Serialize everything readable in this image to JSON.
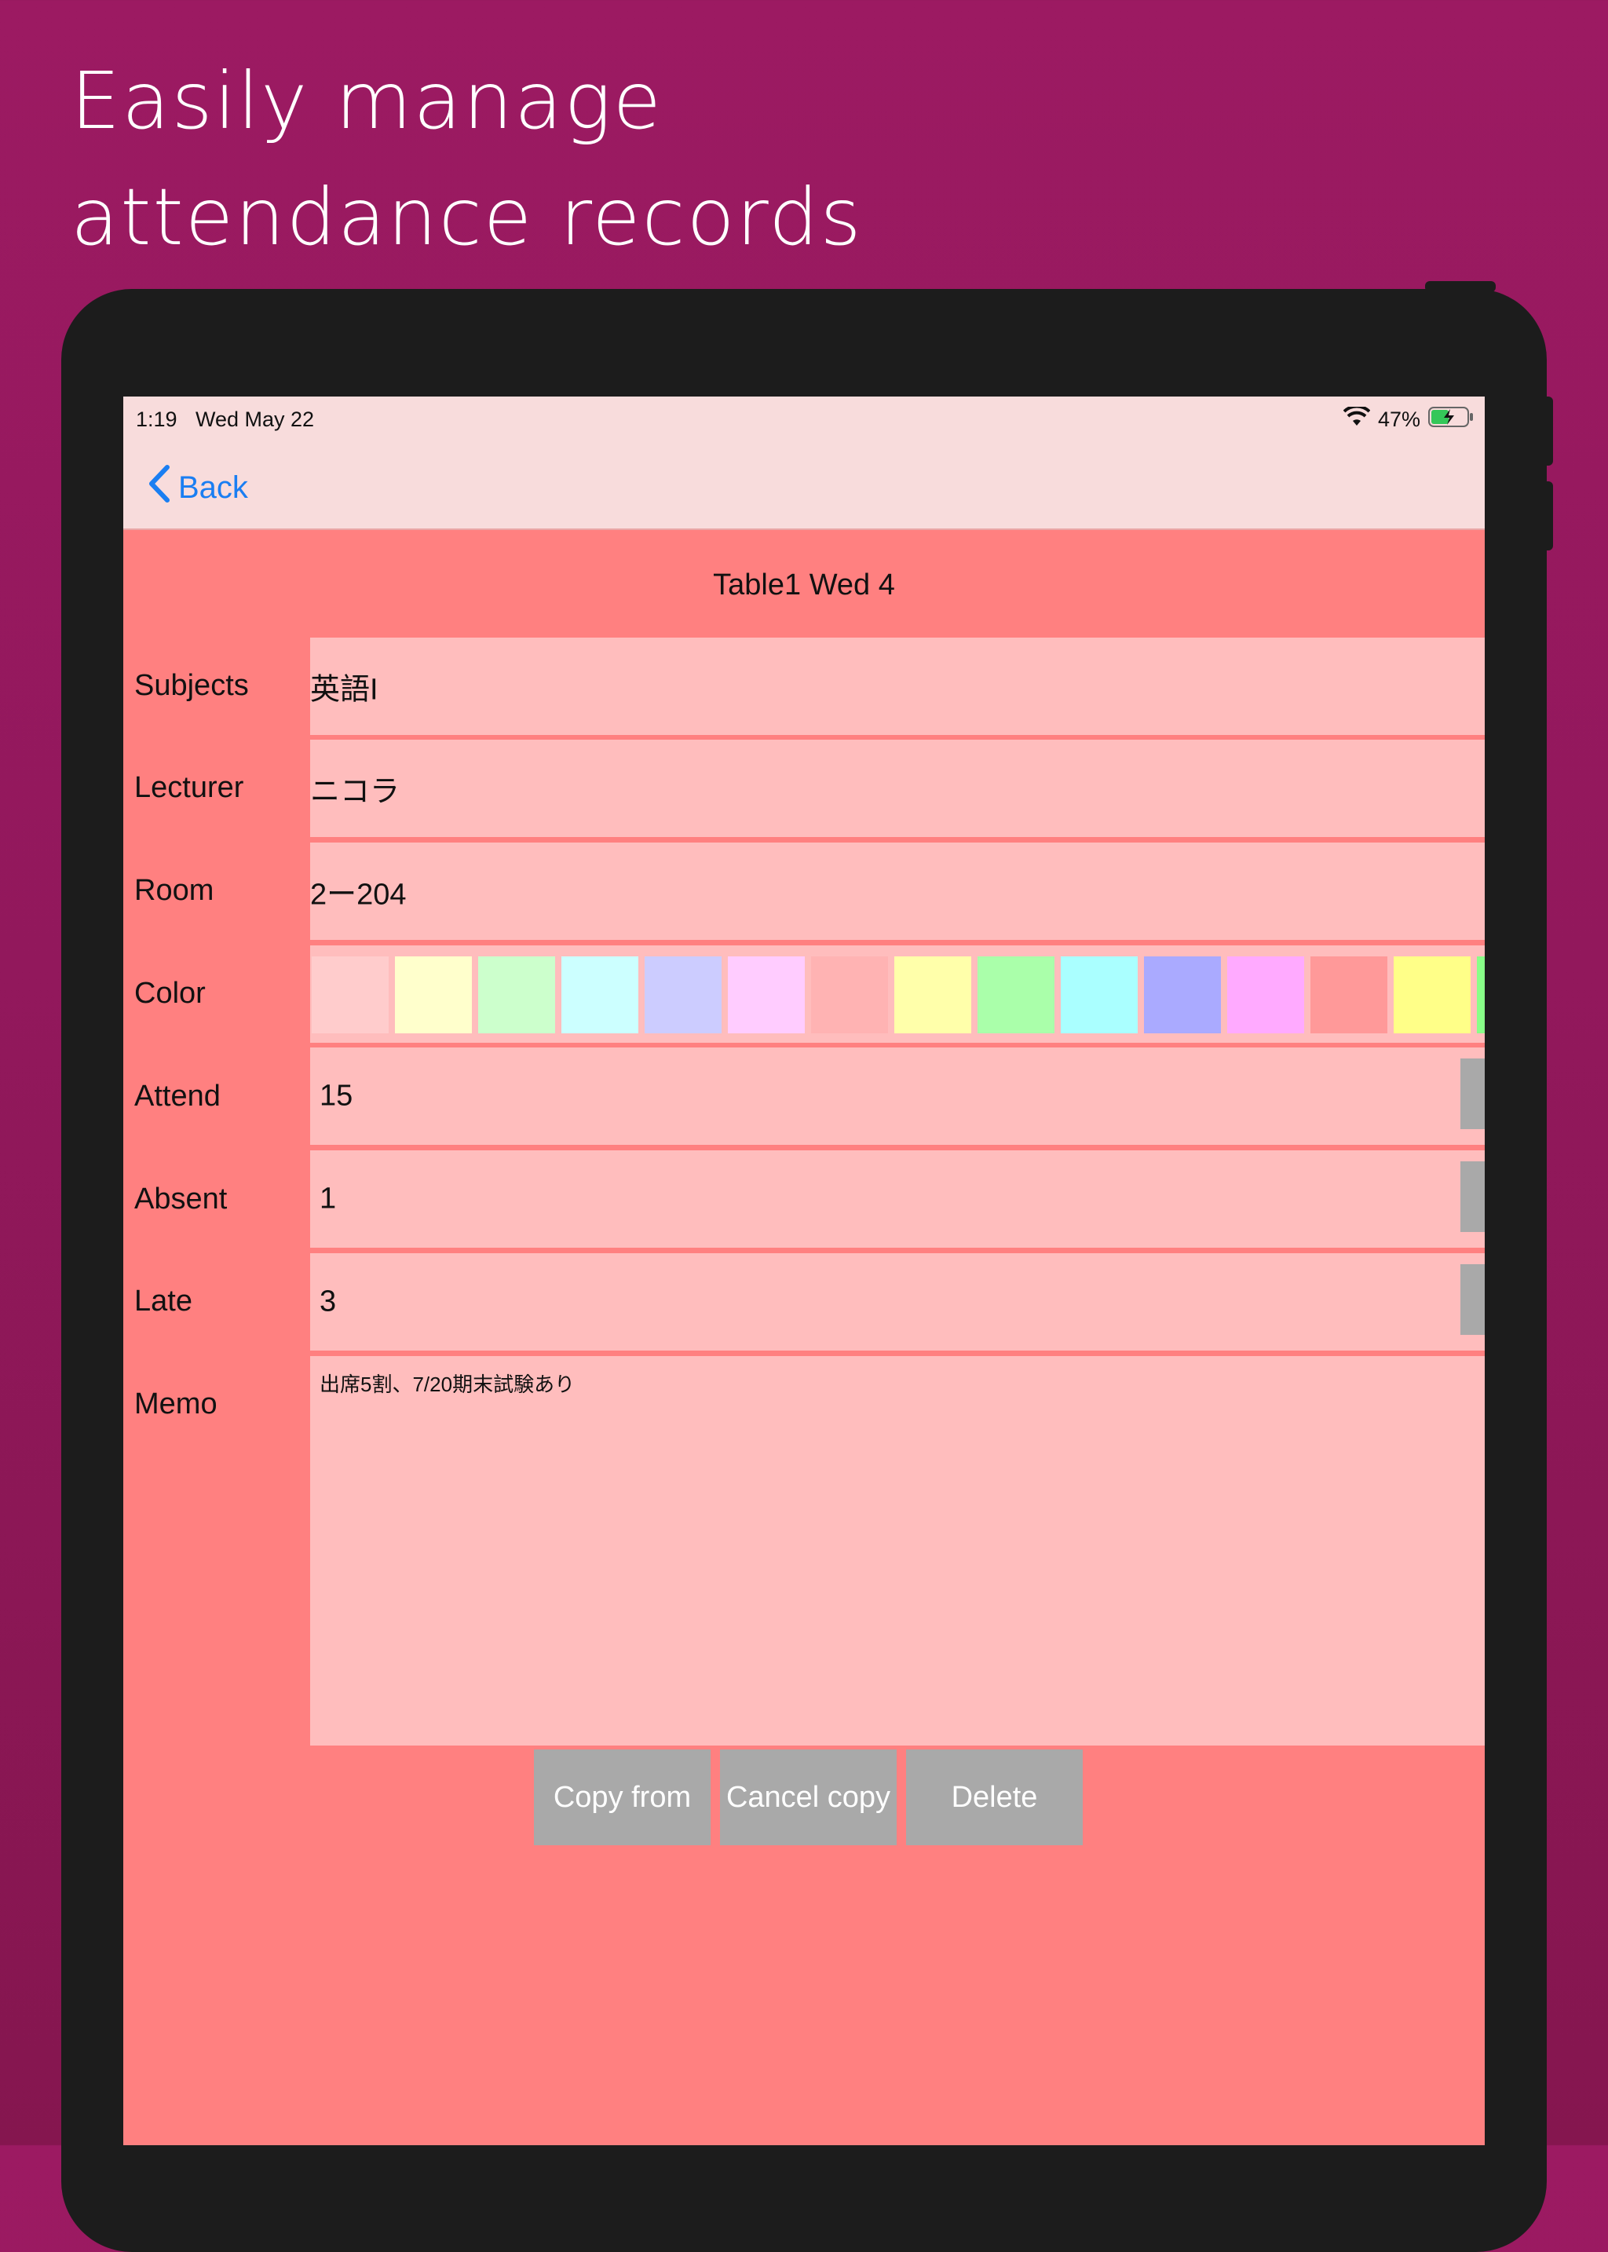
{
  "headline": {
    "line1": "Easily manage",
    "line2": "attendance records"
  },
  "status_bar": {
    "time": "1:19",
    "date": "Wed May 22",
    "battery": "47%"
  },
  "nav": {
    "back_label": "Back"
  },
  "title": "Table1 Wed 4",
  "fields": {
    "subjects": {
      "label": "Subjects",
      "value": "英語I"
    },
    "lecturer": {
      "label": "Lecturer",
      "value": "ニコラ"
    },
    "room": {
      "label": "Room",
      "value": "2ー204"
    },
    "color": {
      "label": "Color"
    },
    "attend": {
      "label": "Attend",
      "value": "15"
    },
    "absent": {
      "label": "Absent",
      "value": "1"
    },
    "late": {
      "label": "Late",
      "value": "3"
    },
    "memo": {
      "label": "Memo",
      "value": "出席5割、7/20期末試験あり"
    }
  },
  "stepper": {
    "minus": "-",
    "plus": "+"
  },
  "swatch_colors": [
    "#ffcccc",
    "#ffffcc",
    "#ccffcc",
    "#ccffff",
    "#ccccff",
    "#ffccff",
    "#ffb3b3",
    "#ffffaa",
    "#aaffaa",
    "#aaffff",
    "#aaaaff",
    "#ffaaff",
    "#ff9999",
    "#ffff88",
    "#88ff88"
  ],
  "buttons": {
    "copy_from": "Copy from",
    "cancel_copy": "Cancel copy",
    "delete": "Delete"
  },
  "colors": {
    "background": "#9c1a62",
    "screen": "#ff8080",
    "field": "#ffbdbd",
    "button": "#a9a9a9",
    "link": "#1a7ef2"
  }
}
